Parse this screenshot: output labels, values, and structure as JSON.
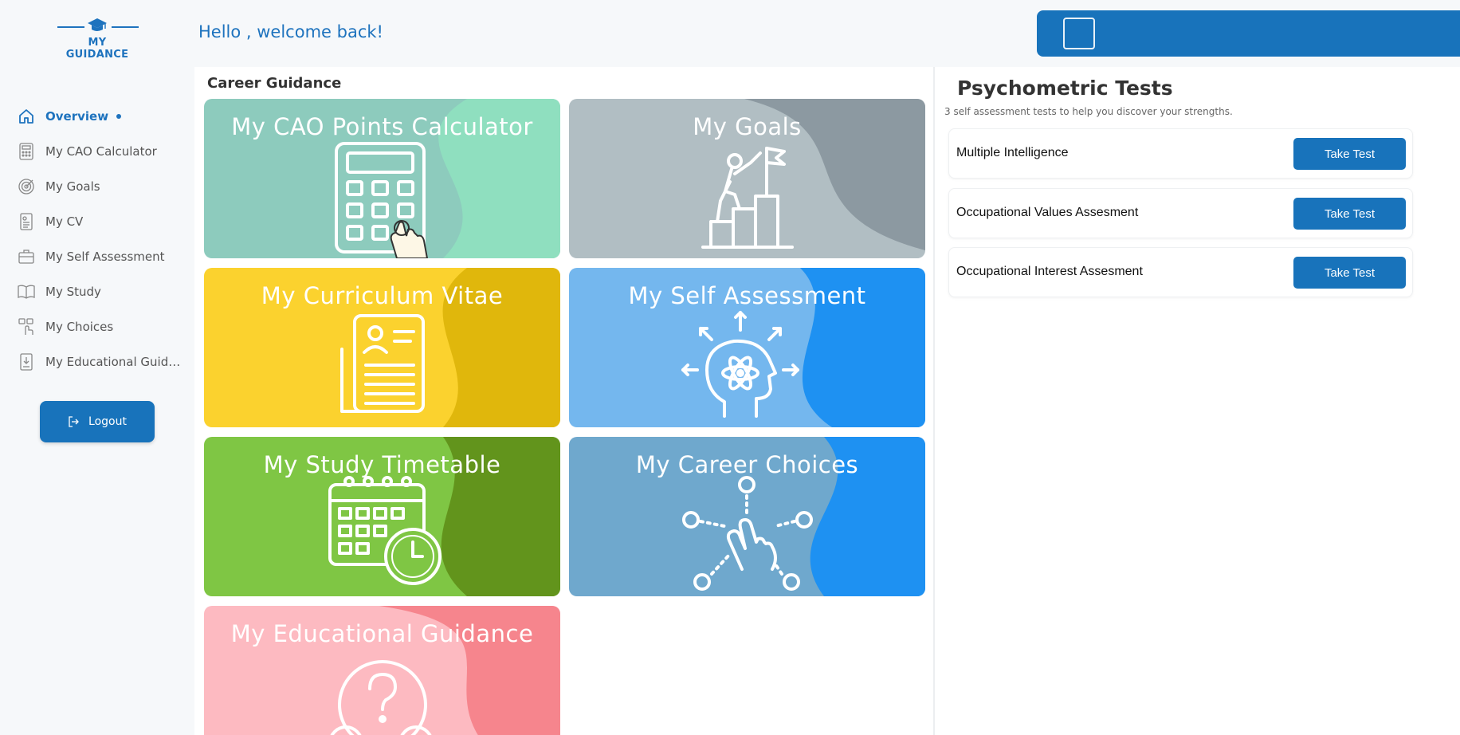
{
  "brand": {
    "name": "MY GUIDANCE",
    "color": "#1e73be"
  },
  "header": {
    "greeting": "Hello , welcome back!"
  },
  "sidebar": {
    "items": [
      {
        "label": "Overview",
        "icon": "home-icon",
        "active": true
      },
      {
        "label": "My CAO Calculator",
        "icon": "calculator-icon"
      },
      {
        "label": "My Goals",
        "icon": "target-icon"
      },
      {
        "label": "My CV",
        "icon": "cv-document-icon"
      },
      {
        "label": "My Self Assessment",
        "icon": "briefcase-icon"
      },
      {
        "label": "My Study",
        "icon": "book-icon"
      },
      {
        "label": "My Choices",
        "icon": "hand-choice-icon"
      },
      {
        "label": "My Educational Guidan...",
        "icon": "education-doc-icon"
      }
    ],
    "logout_label": "Logout"
  },
  "career_guidance": {
    "title": "Career Guidance",
    "cards": [
      {
        "title": "My CAO Points Calculator",
        "icon": "calculator-icon",
        "base": "#8dcbbd",
        "accent": "#8fdfbf"
      },
      {
        "title": "My Goals",
        "icon": "goal-flag-icon",
        "base": "#b1bec3",
        "accent": "#8c99a1"
      },
      {
        "title": "My Curriculum Vitae",
        "icon": "cv-document-icon",
        "base": "#fbd22e",
        "accent": "#e0b70c"
      },
      {
        "title": "My Self Assessment",
        "icon": "brain-atom-icon",
        "base": "#74b7ee",
        "accent": "#1e91f2"
      },
      {
        "title": "My Study Timetable",
        "icon": "calendar-clock-icon",
        "base": "#7fc644",
        "accent": "#62941c"
      },
      {
        "title": "My Career Choices",
        "icon": "hand-choice-icon",
        "base": "#6fa8cd",
        "accent": "#1e91f2"
      },
      {
        "title": "My Educational Guidance",
        "icon": "question-head-icon",
        "base": "#fdbac1",
        "accent": "#f6858d"
      }
    ]
  },
  "psychometric": {
    "title": "Psychometric Tests",
    "subtitle": "3 self assessment tests to help you discover your strengths.",
    "tests": [
      {
        "name": "Multiple Intelligence",
        "button": "Take Test"
      },
      {
        "name": "Occupational Values Assesment",
        "button": "Take Test"
      },
      {
        "name": "Occupational Interest Assesment",
        "button": "Take Test"
      }
    ]
  }
}
